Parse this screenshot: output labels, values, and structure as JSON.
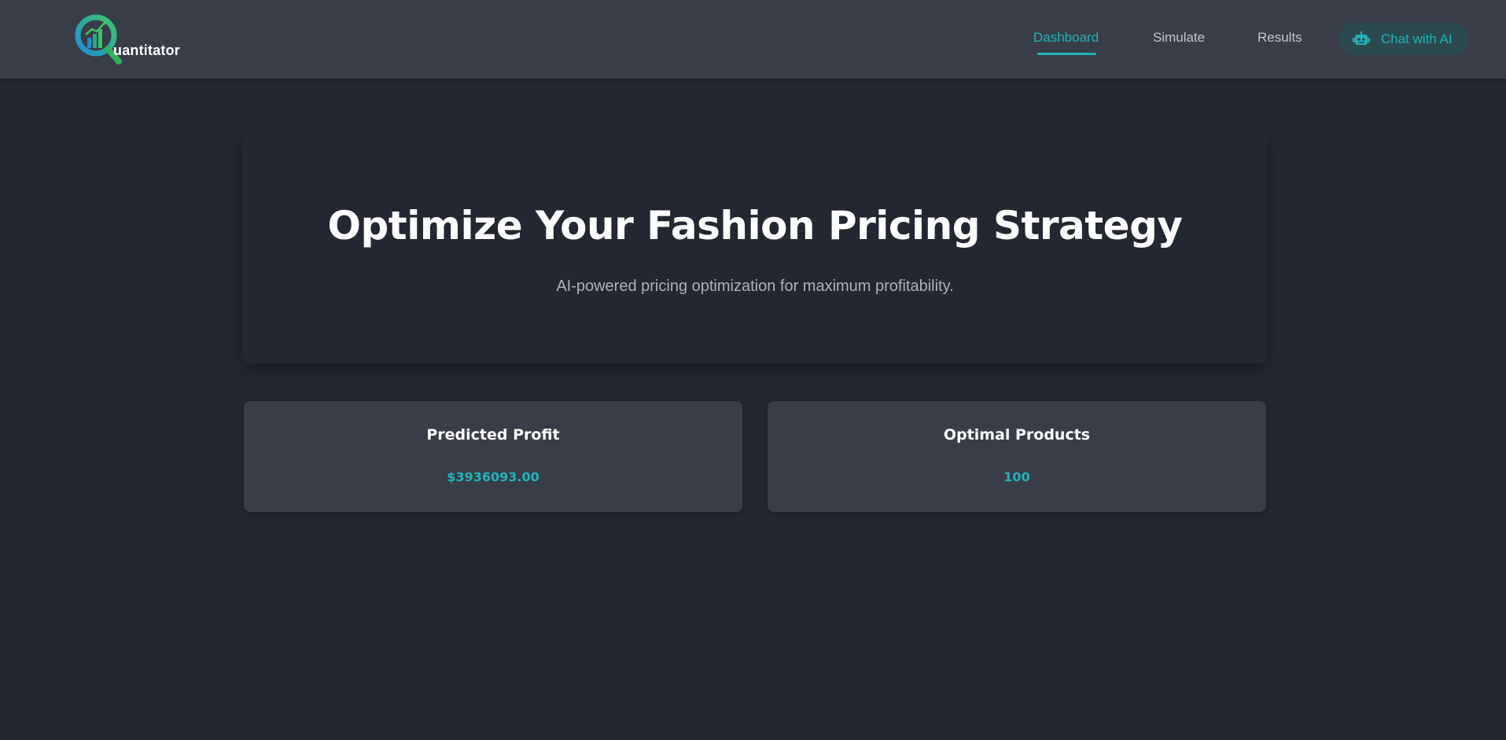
{
  "app": {
    "logo_text": "uantitator"
  },
  "nav": {
    "links": [
      {
        "label": "Dashboard",
        "active": true
      },
      {
        "label": "Simulate",
        "active": false
      },
      {
        "label": "Results",
        "active": false
      }
    ],
    "chat_button": {
      "label": "Chat with AI",
      "icon": "robot-icon"
    }
  },
  "hero": {
    "title": "Optimize Your Fashion Pricing Strategy",
    "subtitle": "AI-powered pricing optimization for maximum profitability."
  },
  "stats": [
    {
      "title": "Predicted Profit",
      "value": "$3936093.00"
    },
    {
      "title": "Optimal Products",
      "value": "100"
    }
  ],
  "colors": {
    "accent": "#1fb4b9",
    "navbar_bg": "#393d48",
    "page_bg": "#222731",
    "card_bg": "#393d48",
    "logo_green": "#3cc46b",
    "logo_blue": "#1e8fd6"
  }
}
